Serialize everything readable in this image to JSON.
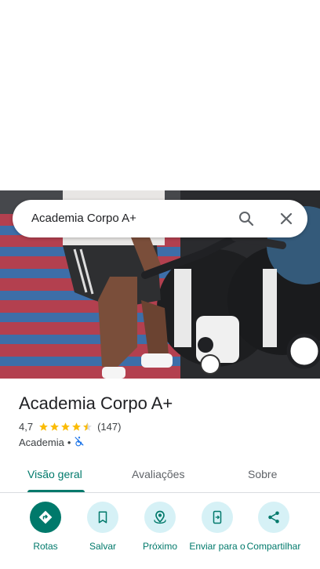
{
  "search": {
    "query": "Academia Corpo A+"
  },
  "place": {
    "name": "Academia Corpo A+",
    "rating": "4,7",
    "stars": 4.5,
    "reviews_count": "(147)",
    "category": "Academia",
    "separator": "•",
    "accessibility_icon": "no-wheelchair-icon"
  },
  "tabs": [
    {
      "label": "Visão geral"
    },
    {
      "label": "Avaliações"
    },
    {
      "label": "Sobre"
    }
  ],
  "actions": [
    {
      "label": "Rotas",
      "icon": "directions-icon"
    },
    {
      "label": "Salvar",
      "icon": "bookmark-icon"
    },
    {
      "label": "Próximo",
      "icon": "nearby-icon"
    },
    {
      "label": "Enviar para o",
      "icon": "send-to-phone-icon"
    },
    {
      "label": "Compartilhar",
      "icon": "share-icon"
    }
  ],
  "colors": {
    "accent": "#00796b",
    "action_bg": "#d6f1f6",
    "star": "#fbbc04"
  }
}
